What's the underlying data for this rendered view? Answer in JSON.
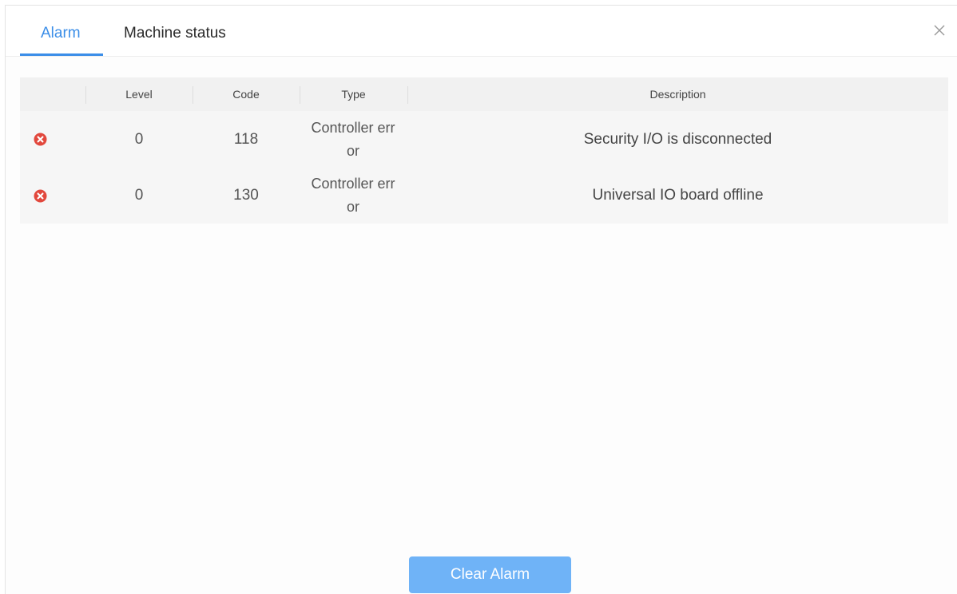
{
  "tabs": {
    "alarm_label": "Alarm",
    "machine_status_label": "Machine status"
  },
  "close_icon": "close-icon",
  "table": {
    "headers": {
      "icon": "",
      "level": "Level",
      "code": "Code",
      "type": "Type",
      "description": "Description"
    },
    "rows": [
      {
        "icon": "error-icon",
        "level": "0",
        "code": "118",
        "type": "Controller error",
        "description": "Security I/O is disconnected"
      },
      {
        "icon": "error-icon",
        "level": "0",
        "code": "130",
        "type": "Controller error",
        "description": "Universal IO board offline"
      }
    ]
  },
  "clear_button_label": "Clear Alarm",
  "colors": {
    "accent": "#3b8ee8",
    "button": "#6fb3f7",
    "error": "#e2483d"
  }
}
